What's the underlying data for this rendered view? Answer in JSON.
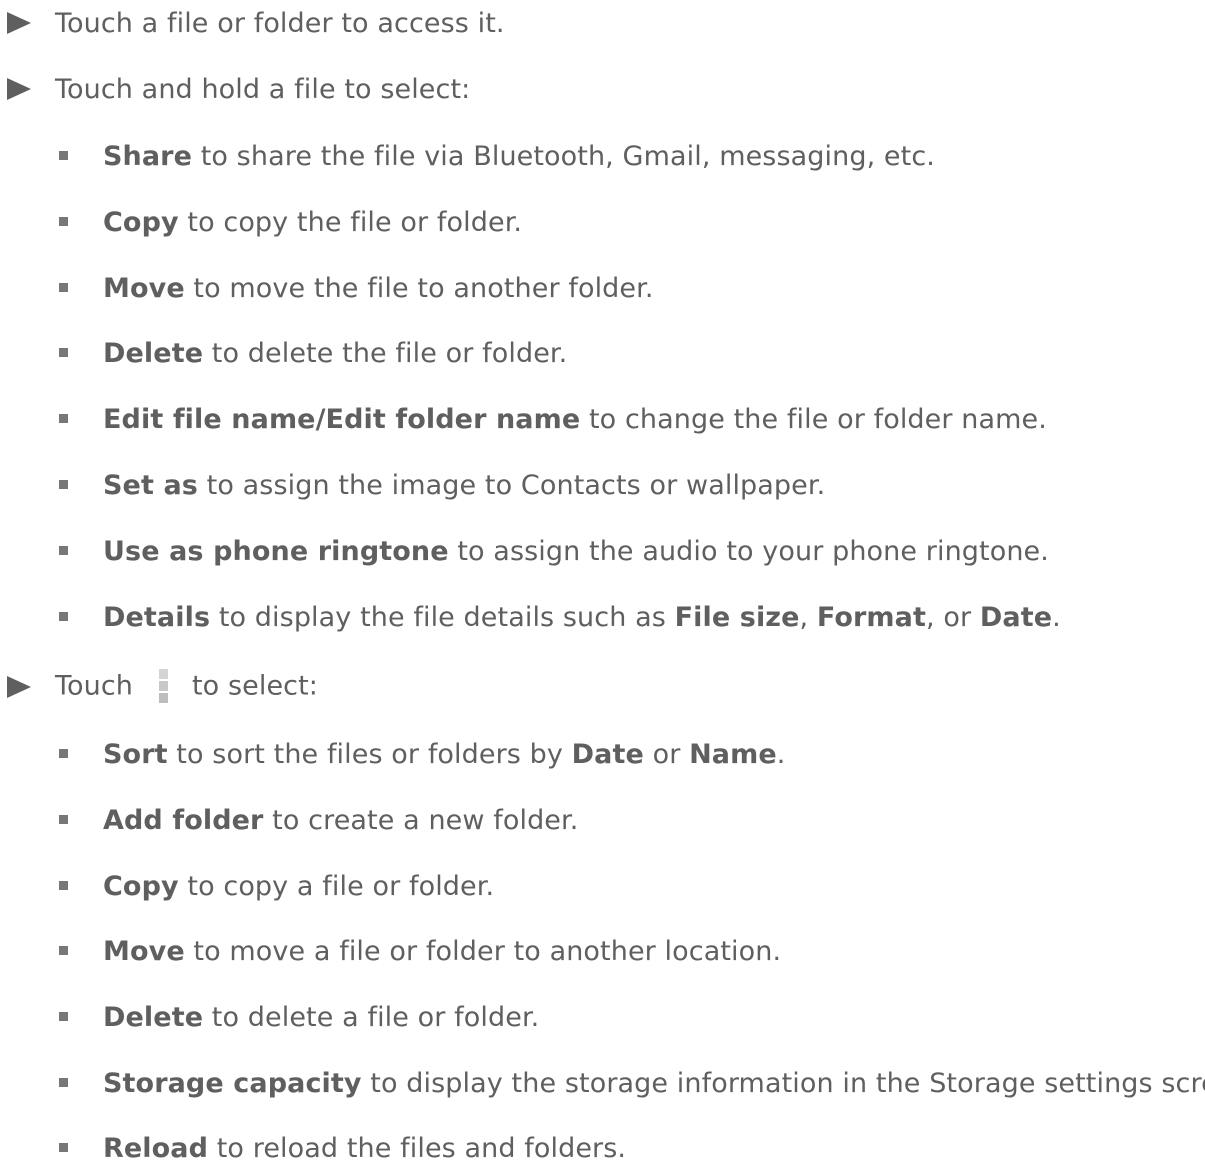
{
  "top_items": [
    {
      "text": "Touch a file or folder to access it."
    },
    {
      "text": "Touch and hold a file to select:"
    },
    {
      "before_icon": "Touch",
      "icon": "overflow-menu-icon",
      "after_icon": "to select:"
    }
  ],
  "hold_items": [
    {
      "b": "Share",
      "t": " to share the file via Bluetooth, Gmail, messaging, etc."
    },
    {
      "b": "Copy",
      "t": " to copy the file or folder."
    },
    {
      "b": "Move",
      "t": " to move the file to another folder."
    },
    {
      "b": "Delete",
      "t": " to delete the file or folder."
    },
    {
      "b": "Edit file name/Edit folder name",
      "t": " to change the file or folder name."
    },
    {
      "b": "Set as",
      "t": " to assign the image to Contacts or wallpaper."
    },
    {
      "b": "Use as phone ringtone",
      "t": " to assign the audio to your phone ringtone."
    },
    {
      "b": "Details",
      "t": " to display the file details such as ",
      "b2": "File size",
      "t2": ", ",
      "b3": "Format",
      "t3": ", or ",
      "b4": "Date",
      "t4": "."
    }
  ],
  "menu_items": [
    {
      "b": "Sort",
      "t": " to sort the files or folders by ",
      "b2": "Date",
      "t2": " or ",
      "b3": "Name",
      "t3": "."
    },
    {
      "b": "Add folder",
      "t": " to create a new folder."
    },
    {
      "b": "Copy",
      "t": " to copy a file or folder."
    },
    {
      "b": "Move",
      "t": " to move a file or folder to another location."
    },
    {
      "b": "Delete",
      "t": " to delete a file or folder."
    },
    {
      "b": "Storage capacity",
      "t": " to display the storage information in the Storage settings screen."
    },
    {
      "b": "Reload",
      "t": " to reload the files and folders."
    }
  ]
}
